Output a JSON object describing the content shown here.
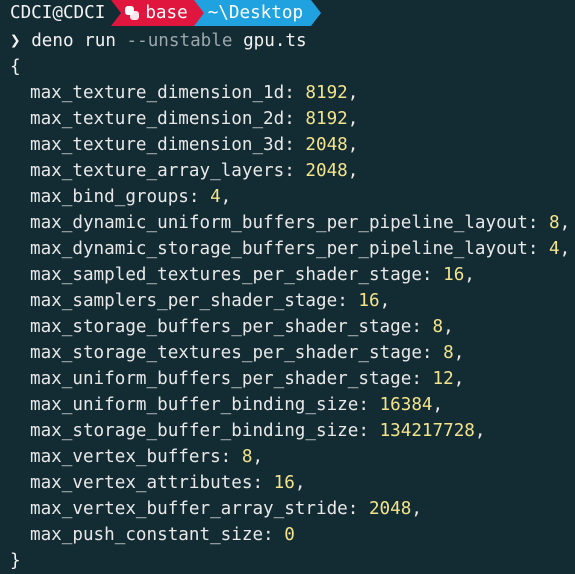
{
  "prompt": {
    "user_host": "CDCI@CDCI",
    "env_name": "base",
    "cwd": "~\\Desktop",
    "colors": {
      "env_bg": "#e0163e",
      "dir_bg": "#1fa2df"
    },
    "env_icon": "python-icon"
  },
  "command": {
    "chevron": "❯",
    "program": "deno",
    "subcommand": "run",
    "flag": "--unstable",
    "file": "gpu.ts"
  },
  "output": {
    "open_brace": "{",
    "close_brace": "}",
    "entries": [
      {
        "key": "max_texture_dimension_1d",
        "value": "8192",
        "sep": ","
      },
      {
        "key": "max_texture_dimension_2d",
        "value": "8192",
        "sep": ","
      },
      {
        "key": "max_texture_dimension_3d",
        "value": "2048",
        "sep": ","
      },
      {
        "key": "max_texture_array_layers",
        "value": "2048",
        "sep": ","
      },
      {
        "key": "max_bind_groups",
        "value": "4",
        "sep": ","
      },
      {
        "key": "max_dynamic_uniform_buffers_per_pipeline_layout",
        "value": "8",
        "sep": ","
      },
      {
        "key": "max_dynamic_storage_buffers_per_pipeline_layout",
        "value": "4",
        "sep": ","
      },
      {
        "key": "max_sampled_textures_per_shader_stage",
        "value": "16",
        "sep": ","
      },
      {
        "key": "max_samplers_per_shader_stage",
        "value": "16",
        "sep": ","
      },
      {
        "key": "max_storage_buffers_per_shader_stage",
        "value": "8",
        "sep": ","
      },
      {
        "key": "max_storage_textures_per_shader_stage",
        "value": "8",
        "sep": ","
      },
      {
        "key": "max_uniform_buffers_per_shader_stage",
        "value": "12",
        "sep": ","
      },
      {
        "key": "max_uniform_buffer_binding_size",
        "value": "16384",
        "sep": ","
      },
      {
        "key": "max_storage_buffer_binding_size",
        "value": "134217728",
        "sep": ","
      },
      {
        "key": "max_vertex_buffers",
        "value": "8",
        "sep": ","
      },
      {
        "key": "max_vertex_attributes",
        "value": "16",
        "sep": ","
      },
      {
        "key": "max_vertex_buffer_array_stride",
        "value": "2048",
        "sep": ","
      },
      {
        "key": "max_push_constant_size",
        "value": "0",
        "sep": ""
      }
    ]
  }
}
